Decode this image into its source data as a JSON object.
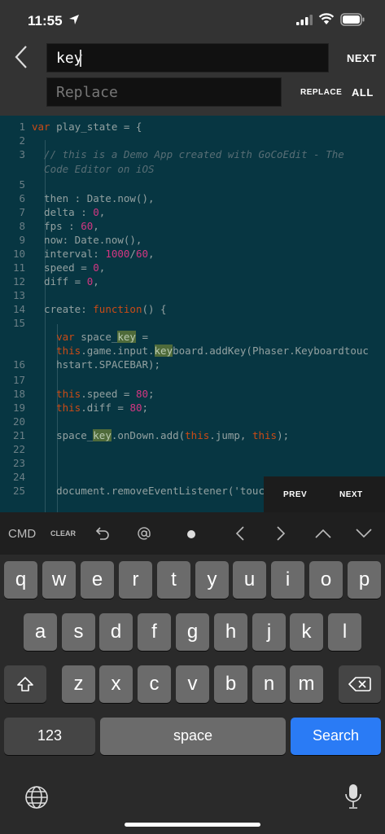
{
  "status_bar": {
    "time": "11:55"
  },
  "find_panel": {
    "find_value": "key",
    "replace_placeholder": "Replace",
    "next_label": "NEXT",
    "replace_label": "REPLACE",
    "all_label": "ALL"
  },
  "editor": {
    "line_numbers": [
      "1",
      "2",
      "3",
      "",
      "5",
      "6",
      "7",
      "8",
      "9",
      "10",
      "11",
      "12",
      "13",
      "14",
      "15",
      "",
      "",
      "16",
      "17",
      "18",
      "19",
      "20",
      "21",
      "22",
      "23",
      "24",
      "25"
    ],
    "search_term": "key"
  },
  "match_nav": {
    "prev_label": "PREV",
    "next_label": "NEXT"
  },
  "command_bar": {
    "cmd_label": "CMD",
    "clear_label": "CLEAR",
    "icons": [
      "undo-icon",
      "at-icon",
      "dot-icon",
      "chevron-left-icon",
      "chevron-right-icon",
      "chevron-up-icon",
      "chevron-down-icon"
    ]
  },
  "keyboard": {
    "row1": [
      "q",
      "w",
      "e",
      "r",
      "t",
      "y",
      "u",
      "i",
      "o",
      "p"
    ],
    "row2": [
      "a",
      "s",
      "d",
      "f",
      "g",
      "h",
      "j",
      "k",
      "l"
    ],
    "row3": [
      "z",
      "x",
      "c",
      "v",
      "b",
      "n",
      "m"
    ],
    "numbers_label": "123",
    "space_label": "space",
    "search_label": "Search"
  },
  "colors": {
    "editor_bg": "#073642",
    "keyword": "#cb4b16",
    "number": "#d33682",
    "comment": "#586e75",
    "match_highlight": "#4f6b3a",
    "search_key": "#2a7bf5"
  }
}
